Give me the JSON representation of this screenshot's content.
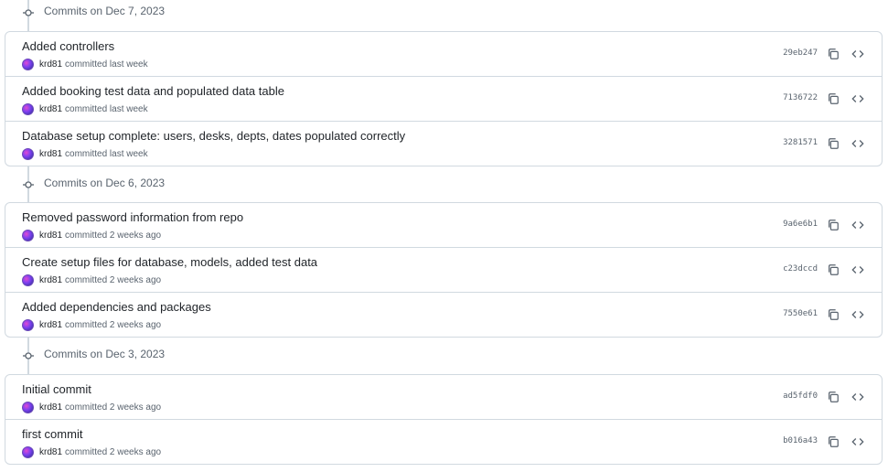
{
  "groups": [
    {
      "label": "Commits on Dec 7, 2023",
      "commits": [
        {
          "title": "Added controllers",
          "author": "krd81",
          "meta": "committed last week",
          "sha": "29eb247"
        },
        {
          "title": "Added booking test data and populated data table",
          "author": "krd81",
          "meta": "committed last week",
          "sha": "7136722"
        },
        {
          "title": "Database setup complete: users, desks, depts, dates populated correctly",
          "author": "krd81",
          "meta": "committed last week",
          "sha": "3281571"
        }
      ]
    },
    {
      "label": "Commits on Dec 6, 2023",
      "commits": [
        {
          "title": "Removed password information from repo",
          "author": "krd81",
          "meta": "committed 2 weeks ago",
          "sha": "9a6e6b1"
        },
        {
          "title": "Create setup files for database, models, added test data",
          "author": "krd81",
          "meta": "committed 2 weeks ago",
          "sha": "c23dccd"
        },
        {
          "title": "Added dependencies and packages",
          "author": "krd81",
          "meta": "committed 2 weeks ago",
          "sha": "7550e61"
        }
      ]
    },
    {
      "label": "Commits on Dec 3, 2023",
      "commits": [
        {
          "title": "Initial commit",
          "author": "krd81",
          "meta": "committed 2 weeks ago",
          "sha": "ad5fdf0"
        },
        {
          "title": "first commit",
          "author": "krd81",
          "meta": "committed 2 weeks ago",
          "sha": "b016a43"
        }
      ]
    }
  ],
  "icons": {
    "commit_node": "git-commit-icon",
    "copy": "copy-icon",
    "browse": "code-icon"
  }
}
